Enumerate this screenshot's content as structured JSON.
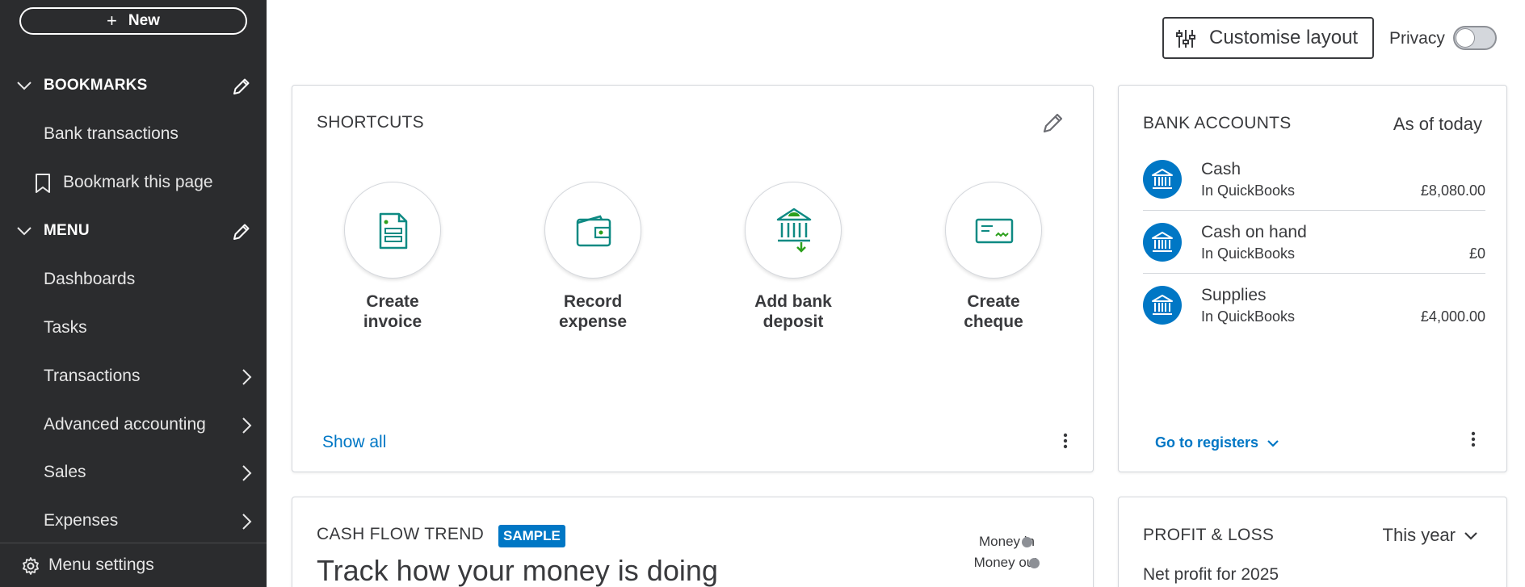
{
  "sidebar": {
    "new_label": "New",
    "bookmarks": {
      "title": "BOOKMARKS",
      "items": [
        "Bank transactions",
        "Bookmark this page"
      ]
    },
    "menu": {
      "title": "MENU",
      "items": [
        "Dashboards",
        "Tasks",
        "Transactions",
        "Advanced accounting",
        "Sales",
        "Expenses"
      ]
    },
    "footer_label": "Menu settings"
  },
  "topbar": {
    "customise_label": "Customise layout",
    "privacy_label": "Privacy",
    "privacy_on": false
  },
  "shortcuts": {
    "title": "SHORTCUTS",
    "items": [
      {
        "line1": "Create",
        "line2": "invoice",
        "icon": "invoice-icon"
      },
      {
        "line1": "Record",
        "line2": "expense",
        "icon": "wallet-icon"
      },
      {
        "line1": "Add bank",
        "line2": "deposit",
        "icon": "bank-deposit-icon"
      },
      {
        "line1": "Create",
        "line2": "cheque",
        "icon": "cheque-icon"
      }
    ],
    "show_all": "Show all"
  },
  "bank_accounts": {
    "title": "BANK ACCOUNTS",
    "as_of": "As of today",
    "accounts": [
      {
        "name": "Cash",
        "source": "In QuickBooks",
        "amount": "£8,080.00"
      },
      {
        "name": "Cash on hand",
        "source": "In QuickBooks",
        "amount": "£0"
      },
      {
        "name": "Supplies",
        "source": "In QuickBooks",
        "amount": "£4,000.00"
      }
    ],
    "go_to_registers": "Go to registers"
  },
  "cash_flow": {
    "title": "CASH FLOW TREND",
    "badge": "SAMPLE",
    "heading": "Track how your money is doing",
    "legend": [
      "Money in",
      "Money out"
    ]
  },
  "profit_loss": {
    "title": "PROFIT & LOSS",
    "period": "This year",
    "subtitle": "Net profit for 2025"
  },
  "colors": {
    "sidebar_bg": "#2b2c2e",
    "link_blue": "#0077c5",
    "icon_teal": "#0e8a83",
    "icon_green": "#2ca01c"
  }
}
